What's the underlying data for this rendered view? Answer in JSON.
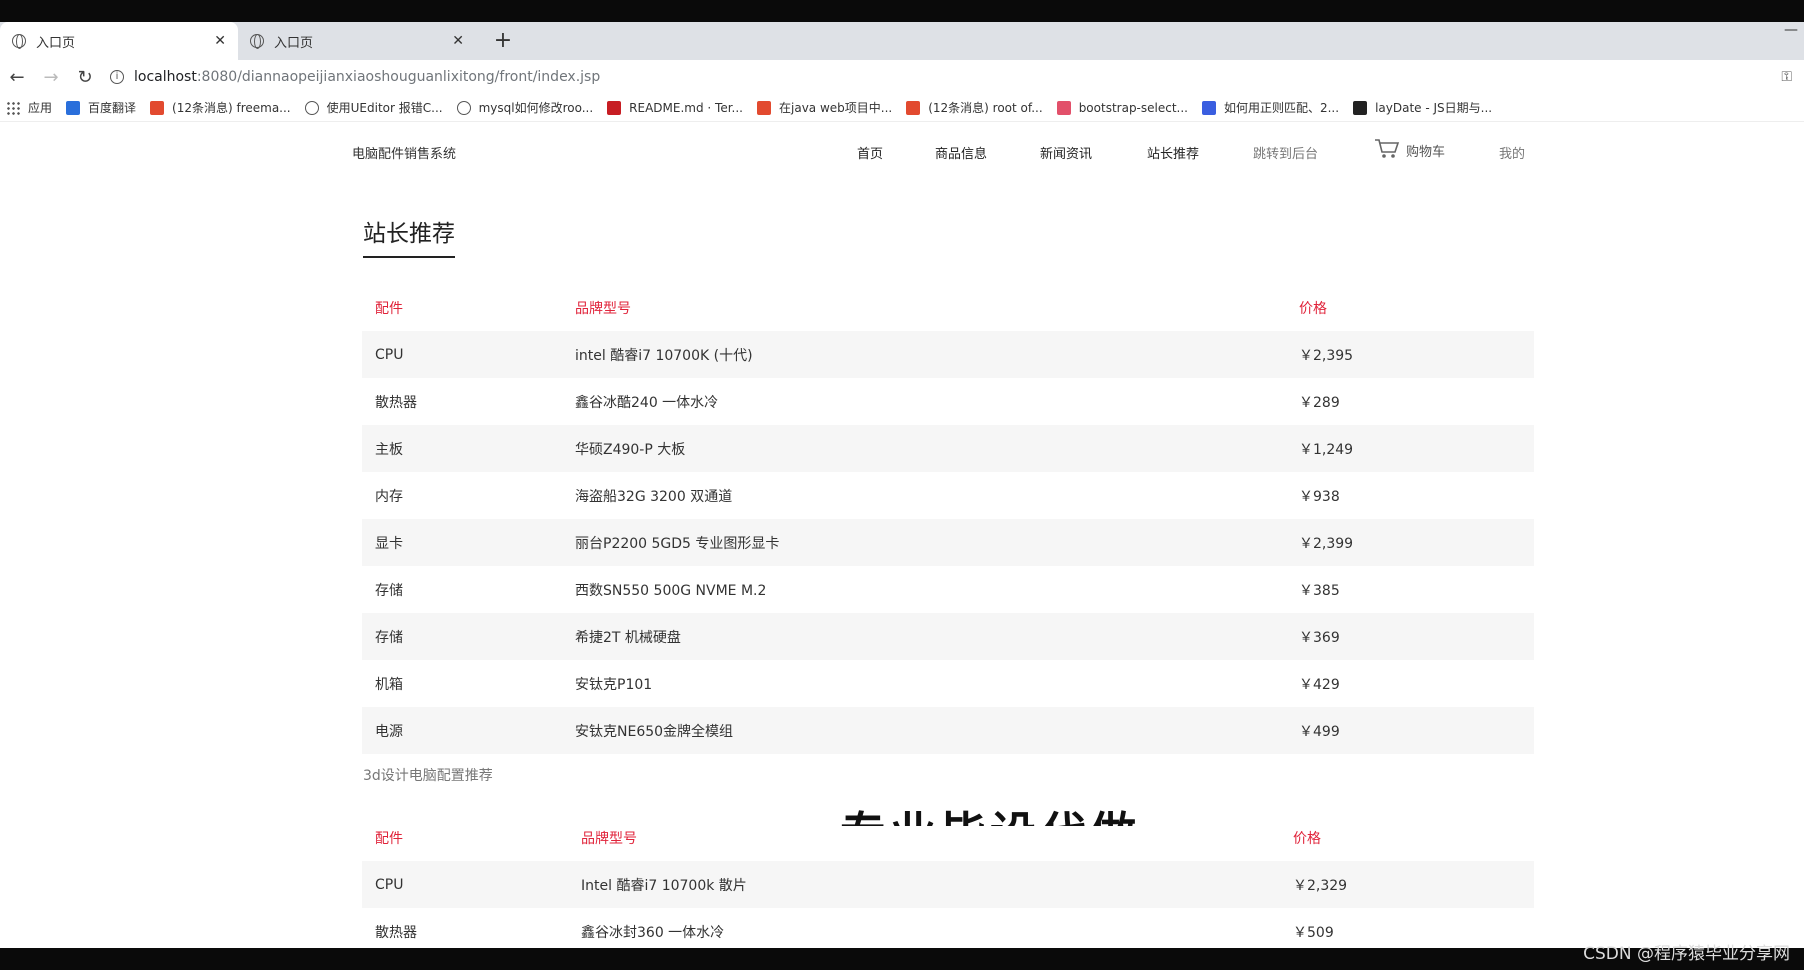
{
  "browser": {
    "tabs": [
      {
        "label": "入口页"
      },
      {
        "label": "入口页"
      }
    ],
    "url_host": "localhost",
    "url_path": ":8080/diannaopeijianxiaoshouguanlixitong/front/index.jsp",
    "bookmarks": [
      {
        "label": "应用",
        "icon": "apps-icon"
      },
      {
        "label": "百度翻译",
        "icon": "baidu-translate-icon",
        "color": "#2a6fdb"
      },
      {
        "label": "(12条消息) freema...",
        "icon": "csdn-icon",
        "color": "#e24a2f"
      },
      {
        "label": "使用UEditor 报错C...",
        "icon": "bookmark-icon"
      },
      {
        "label": "mysql如何修改roo...",
        "icon": "bookmark-icon"
      },
      {
        "label": "README.md · Ter...",
        "icon": "gitee-icon",
        "color": "#c71d23"
      },
      {
        "label": "在java web项目中...",
        "icon": "csdn-icon",
        "color": "#e24a2f"
      },
      {
        "label": "(12条消息) root of...",
        "icon": "csdn-icon",
        "color": "#e24a2f"
      },
      {
        "label": "bootstrap-select...",
        "icon": "bootstrap-icon",
        "color": "#e2506a"
      },
      {
        "label": "如何用正则匹配、2...",
        "icon": "baidu-icon",
        "color": "#3a5ee0"
      },
      {
        "label": "layDate - JS日期与...",
        "icon": "layui-icon",
        "color": "#222"
      }
    ]
  },
  "site": {
    "brand": "电脑配件销售系统",
    "nav": [
      "首页",
      "商品信息",
      "新闻资讯",
      "站长推荐",
      "跳转到后台"
    ],
    "cart_label": "购物车",
    "mine_label": "我的"
  },
  "section_title": "站长推荐",
  "table1": {
    "headers": [
      "配件",
      "品牌型号",
      "价格"
    ],
    "rows": [
      [
        "CPU",
        "intel 酷睿i7 10700K (十代)",
        "￥2,395"
      ],
      [
        "散热器",
        "鑫谷冰酷240 一体水冷",
        "￥289"
      ],
      [
        "主板",
        "华硕Z490-P 大板",
        "￥1,249"
      ],
      [
        "内存",
        "海盗船32G 3200 双通道",
        "￥938"
      ],
      [
        "显卡",
        "丽台P2200 5GD5 专业图形显卡",
        "￥2,399"
      ],
      [
        "存储",
        "西数SN550 500G NVME M.2",
        "￥385"
      ],
      [
        "存储",
        "希捷2T 机械硬盘",
        "￥369"
      ],
      [
        "机箱",
        "安钛克P101",
        "￥429"
      ],
      [
        "电源",
        "安钛克NE650金牌全模组",
        "￥499"
      ]
    ]
  },
  "caption": "3d设计电脑配置推荐",
  "table2": {
    "headers": [
      "配件",
      "品牌型号",
      "价格"
    ],
    "rows": [
      [
        "CPU",
        "Intel 酷睿i7 10700k 散片",
        "￥2,329"
      ],
      [
        "散热器",
        "鑫谷冰封360 一体水冷",
        "￥509"
      ]
    ]
  },
  "overlay_text": "专业毕设代做",
  "watermark": "CSDN @程序猿毕业分享网"
}
